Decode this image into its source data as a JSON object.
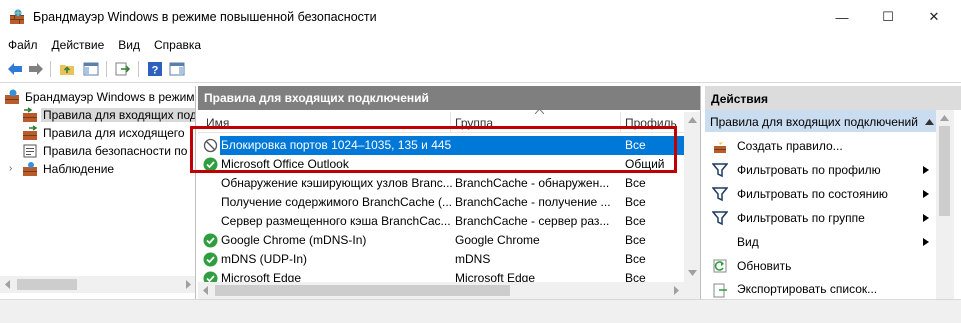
{
  "window": {
    "title": "Брандмауэр Windows в режиме повышенной безопасности",
    "minimize_glyph": "—",
    "maximize_glyph": "☐",
    "close_glyph": "✕"
  },
  "menu": [
    "Файл",
    "Действие",
    "Вид",
    "Справка"
  ],
  "tree": {
    "root": "Брандмауэр Windows в режим",
    "items": [
      {
        "label": "Правила для входящих под",
        "icon": "inbound-rules-icon",
        "selected": true
      },
      {
        "label": "Правила для исходящего",
        "icon": "outbound-rules-icon",
        "selected": false
      },
      {
        "label": "Правила безопасности по",
        "icon": "security-rules-icon",
        "selected": false
      },
      {
        "label": "Наблюдение",
        "icon": "monitoring-icon",
        "selected": false
      }
    ]
  },
  "main": {
    "header": "Правила для входящих подключений",
    "columns": [
      "Имя",
      "Группа",
      "Профиль"
    ],
    "column_display": [
      "Имя",
      "Группа",
      "Профиль"
    ],
    "rows": [
      {
        "name": "Блокировка портов 1024–1035, 135 и 445",
        "group": "",
        "profile": "Все",
        "status": "blocked",
        "selected": true
      },
      {
        "name": "Microsoft Office Outlook",
        "group": "",
        "profile": "Общий",
        "status": "allowed",
        "selected": false
      },
      {
        "name": "Обнаружение кэширующих узлов Branc...",
        "group": "BranchCache - обнаружен...",
        "profile": "Все",
        "status": "none",
        "selected": false
      },
      {
        "name": "Получение содержимого BranchCache (...",
        "group": "BranchCache - получение ...",
        "profile": "Все",
        "status": "none",
        "selected": false
      },
      {
        "name": "Сервер размещенного кэша BranchCac...",
        "group": "BranchCache - сервер раз...",
        "profile": "Все",
        "status": "none",
        "selected": false
      },
      {
        "name": "Google Chrome (mDNS-In)",
        "group": "Google Chrome",
        "profile": "Все",
        "status": "allowed",
        "selected": false
      },
      {
        "name": "mDNS (UDP-In)",
        "group": "mDNS",
        "profile": "Все",
        "status": "allowed",
        "selected": false
      },
      {
        "name": "Microsoft Edge",
        "group": "Microsoft Edge",
        "profile": "Все",
        "status": "allowed",
        "selected": false
      }
    ]
  },
  "actions": {
    "header": "Действия",
    "section": "Правила для входящих подключений",
    "items": [
      {
        "label": "Создать правило...",
        "icon": "new-rule-icon",
        "submenu": false
      },
      {
        "label": "Фильтровать по профилю",
        "icon": "filter-icon",
        "submenu": true
      },
      {
        "label": "Фильтровать по состоянию",
        "icon": "filter-icon",
        "submenu": true
      },
      {
        "label": "Фильтровать по группе",
        "icon": "filter-icon",
        "submenu": true
      },
      {
        "label": "Вид",
        "icon": "",
        "submenu": true
      },
      {
        "label": "Обновить",
        "icon": "refresh-icon",
        "submenu": false
      },
      {
        "label": "Экспортировать список...",
        "icon": "export-icon",
        "submenu": false
      }
    ]
  },
  "colors": {
    "selection": "#0078d7",
    "header_gray": "#7f7f7f",
    "actions_section": "#c9dcf0",
    "highlight_box": "#c00000"
  }
}
